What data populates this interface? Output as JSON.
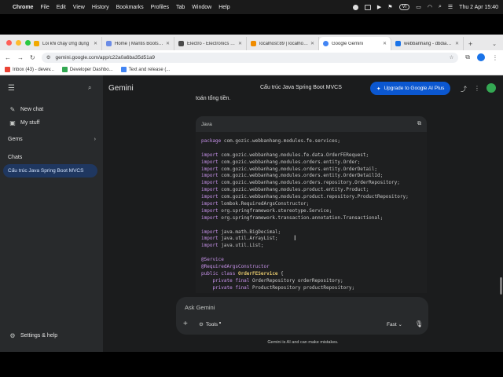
{
  "menubar": {
    "app_name": "Chrome",
    "items": [
      "File",
      "Edit",
      "View",
      "History",
      "Bookmarks",
      "Profiles",
      "Tab",
      "Window",
      "Help"
    ],
    "input_source": "VI",
    "clock": "Thu 2 Apr  15:40"
  },
  "tabs": [
    {
      "label": "Lỗi khi chạy ứng dụng",
      "color": "#f2a900"
    },
    {
      "label": "Home | Mantis Bootstrap",
      "color": "#6b8ce6"
    },
    {
      "label": "Electro - Electronics Web",
      "color": "#4a4a4a"
    },
    {
      "label": "localhost:89 | localhost / ",
      "color": "#f08c00"
    },
    {
      "label": "Google Gemini",
      "color": "#4285f4"
    },
    {
      "label": "webbanhang - dbdiagram",
      "color": "#1a73e8"
    }
  ],
  "address_bar": {
    "url": "gemini.google.com/app/c22a0a6ba35d51a9"
  },
  "bookmarks": [
    {
      "label": "Inbox (43) - devev...",
      "color": "#ea4335"
    },
    {
      "label": "Developer Dashbo...",
      "color": "#34a853"
    },
    {
      "label": "Text and release (...",
      "color": "#4285f4"
    }
  ],
  "sidebar": {
    "new_chat": "New chat",
    "my_stuff": "My stuff",
    "gems": "Gems",
    "chats_heading": "Chats",
    "active_chat": "Cấu trúc Java Spring Boot MVCS",
    "settings": "Settings & help"
  },
  "header": {
    "brand": "Gemini",
    "chat_title": "Cấu trúc Java Spring Boot MVCS",
    "upgrade_label": "Upgrade to Google AI Plus"
  },
  "prose_tail": "toán tổng tiền.",
  "code": {
    "language": "Java",
    "lines": [
      [
        {
          "t": "package ",
          "c": "kw"
        },
        {
          "t": "com.gozic.webbanhang.modules.fe.services;",
          "c": ""
        }
      ],
      [],
      [
        {
          "t": "import ",
          "c": "kw"
        },
        {
          "t": "com.gozic.webbanhang.modules.fe.data.OrderFERequest;",
          "c": ""
        }
      ],
      [
        {
          "t": "import ",
          "c": "kw"
        },
        {
          "t": "com.gozic.webbanhang.modules.orders.entity.Order;",
          "c": ""
        }
      ],
      [
        {
          "t": "import ",
          "c": "kw"
        },
        {
          "t": "com.gozic.webbanhang.modules.orders.entity.OrderDetail;",
          "c": ""
        }
      ],
      [
        {
          "t": "import ",
          "c": "kw"
        },
        {
          "t": "com.gozic.webbanhang.modules.orders.entity.OrderDetailId;",
          "c": ""
        }
      ],
      [
        {
          "t": "import ",
          "c": "kw"
        },
        {
          "t": "com.gozic.webbanhang.modules.orders.repository.OrderRepository;",
          "c": ""
        }
      ],
      [
        {
          "t": "import ",
          "c": "kw"
        },
        {
          "t": "com.gozic.webbanhang.modules.product.entity.Product;",
          "c": ""
        }
      ],
      [
        {
          "t": "import ",
          "c": "kw"
        },
        {
          "t": "com.gozic.webbanhang.modules.product.repository.ProductRepository;",
          "c": ""
        }
      ],
      [
        {
          "t": "import ",
          "c": "kw"
        },
        {
          "t": "lombok.RequiredArgsConstructor;",
          "c": ""
        }
      ],
      [
        {
          "t": "import ",
          "c": "kw"
        },
        {
          "t": "org.springframework.stereotype.Service;",
          "c": ""
        }
      ],
      [
        {
          "t": "import ",
          "c": "kw"
        },
        {
          "t": "org.springframework.transaction.annotation.Transactional;",
          "c": ""
        }
      ],
      [],
      [
        {
          "t": "import ",
          "c": "kw"
        },
        {
          "t": "java.math.BigDecimal;",
          "c": ""
        }
      ],
      [
        {
          "t": "import ",
          "c": "kw"
        },
        {
          "t": "java.util.ArrayList;",
          "c": ""
        }
      ],
      [
        {
          "t": "import ",
          "c": "kw"
        },
        {
          "t": "java.util.List;",
          "c": ""
        }
      ],
      [],
      [
        {
          "t": "@Service",
          "c": "ann"
        }
      ],
      [
        {
          "t": "@RequiredArgsConstructor",
          "c": "ann"
        }
      ],
      [
        {
          "t": "public class ",
          "c": "kw"
        },
        {
          "t": "OrderFEService",
          "c": "cls"
        },
        {
          "t": " {",
          "c": ""
        }
      ],
      [
        {
          "t": "    private final ",
          "c": "kw"
        },
        {
          "t": "OrderRepository orderRepository;",
          "c": ""
        }
      ],
      [
        {
          "t": "    private final ",
          "c": "kw"
        },
        {
          "t": "ProductRepository productRepository;",
          "c": ""
        }
      ]
    ]
  },
  "input": {
    "placeholder": "Ask Gemini",
    "tools_label": "Tools",
    "mode_label": "Fast"
  },
  "disclaimer": "Gemini is AI and can make mistakes."
}
